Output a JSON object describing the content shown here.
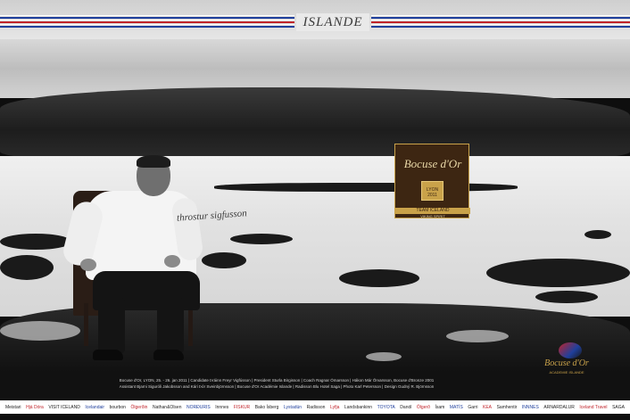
{
  "header": {
    "title": "ISLANDE"
  },
  "figure": {
    "signature": "throstur sigfusson"
  },
  "badge": {
    "brand": "Bocuse d'Or",
    "emblem": "LYON 2011",
    "team": "TEAM ICELAND",
    "tagline": "VIKING SPIRIT"
  },
  "footer_logo": {
    "name": "Bocuse d'Or",
    "sub": "ACADEMIE ISLANDE"
  },
  "credits": [
    "Bocuse d'Or, LYON, 25. - 26. jan 2011 | Candidate Þráinn Freyr Vigfússon | President Sturla Birgisson | Coach Ragnar Ómarsson | Hákon Már Örvarsson, Bocuse d'Bronze 2001",
    "Assistant Bjarni Siguróli Jakobsson and Kári Þór Sveinbjörnsson | Bocuse d'Or Académie Islande | Radisson Blu Hotel Saga | Photo Karl Petersson | Design Gudný R. Björnsson"
  ],
  "sponsors": [
    "Meistari",
    "Hjá Dóra",
    "VISIT ICELAND",
    "Icelandair",
    "bourbon",
    "Ölgerðin",
    "Nathan&Olsen",
    "NORÐURIS",
    "Innnes",
    "FISKUR",
    "Bako Ísberg",
    "Lystadún",
    "Radisson",
    "Lyfja",
    "Landsbankinn",
    "TOYOTA",
    "Danól",
    "Ölgerð",
    "Ísam",
    "MATÍS",
    "Garri",
    "KEA",
    "Samhentir",
    "INNNES",
    "ARNARDALUR",
    "Iceland Travel",
    "SAGA"
  ],
  "colors": {
    "flag_blue": "#1f3f9c",
    "flag_red": "#c0242b",
    "badge_brown": "#3d2612",
    "badge_gold": "#c9a24a"
  }
}
